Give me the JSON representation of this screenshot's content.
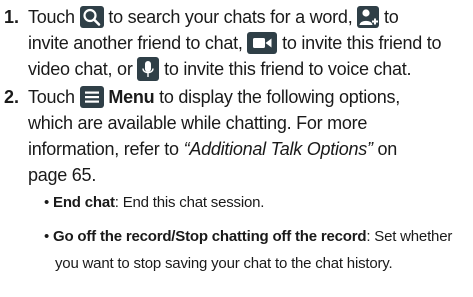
{
  "steps": [
    {
      "number": "1.",
      "line1": {
        "a": "Touch",
        "b": "to search your chats for a word,",
        "c": "to"
      },
      "line2": {
        "a": "invite another friend to chat,",
        "b": "to invite this friend to"
      },
      "line3": {
        "a": "video chat, or",
        "b": "to invite this friend to voice chat."
      },
      "icons": [
        "search-icon",
        "add-friend-icon",
        "video-camera-icon",
        "microphone-icon"
      ]
    },
    {
      "number": "2.",
      "line1": {
        "a": "Touch",
        "menu_label": "Menu",
        "b": "to display the following options,"
      },
      "line2": "which are available while chatting. For more",
      "line3": {
        "a": "information, refer to",
        "ref": "“Additional Talk Options”",
        "b": "on"
      },
      "line4": "page 65.",
      "icons": [
        "menu-icon"
      ],
      "bullets": [
        {
          "term": "End chat",
          "desc": ": End this chat session."
        },
        {
          "term": "Go off the record/Stop chatting off the record",
          "desc": ": Set whether",
          "desc2": "you want to stop saving your chat to the chat history."
        }
      ]
    }
  ],
  "bullet_symbol": "•",
  "colors": {
    "icon_bg": "#2f3f47",
    "text": "#1a1a1a"
  }
}
